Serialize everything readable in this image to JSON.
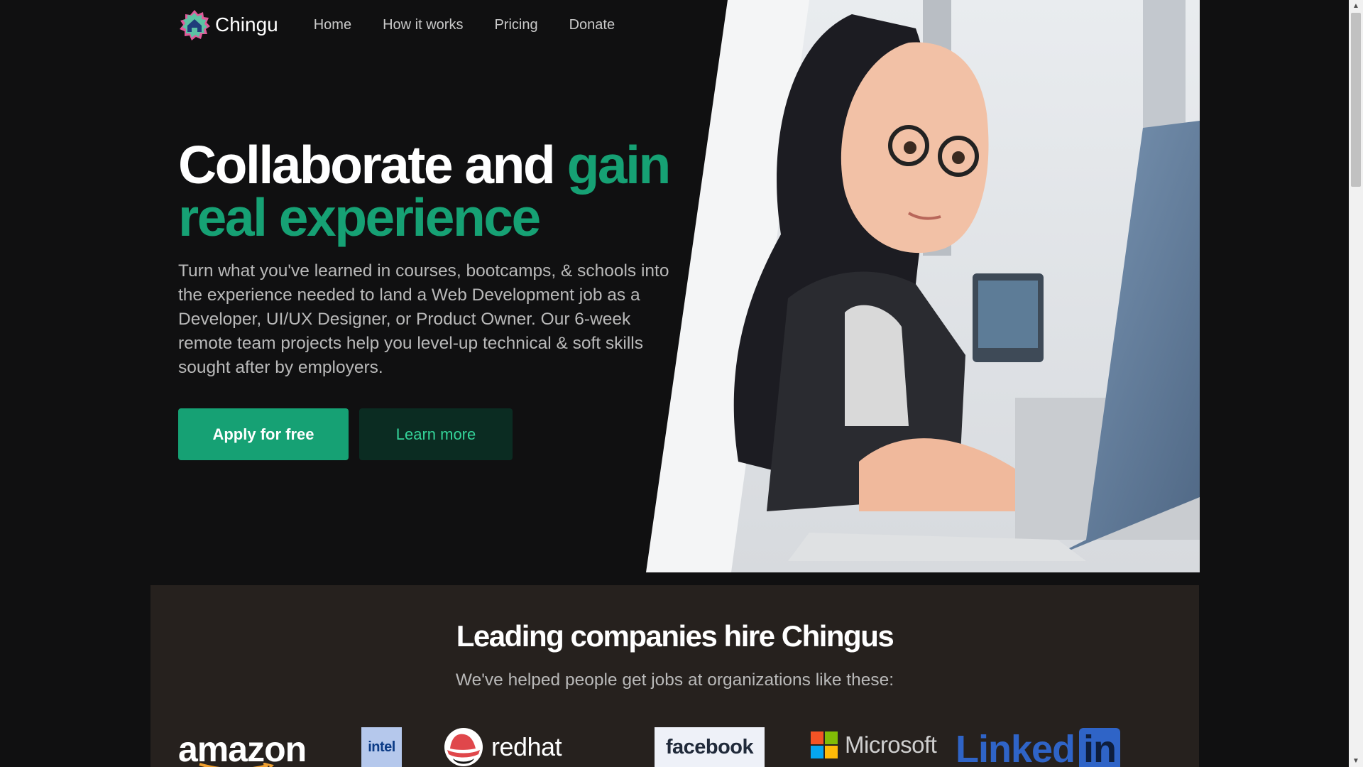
{
  "brand": {
    "name": "Chingu"
  },
  "nav": {
    "links": [
      {
        "label": "Home"
      },
      {
        "label": "How it works"
      },
      {
        "label": "Pricing"
      },
      {
        "label": "Donate"
      }
    ]
  },
  "hero": {
    "title_main": "Collaborate and",
    "title_accent": "gain real experience",
    "description": "Turn what you've learned in courses, bootcamps, & schools into the experience needed to land a Web Development job as a Developer, UI/UX Designer, or Product Owner. Our 6-week remote team projects help you level-up technical & soft skills sought after by employers.",
    "primary_button": "Apply for free",
    "secondary_button": "Learn more"
  },
  "companies": {
    "title": "Leading companies hire Chingus",
    "subtitle": "We've helped people get jobs at organizations like these:",
    "logos": {
      "amazon": "amazon",
      "intel": "intel",
      "redhat": "redhat",
      "facebook": "facebook",
      "microsoft": "Microsoft",
      "linkedin_a": "Linked",
      "linkedin_b": "in"
    }
  },
  "icons": {
    "brand_logo": "chingu-house-logo-icon",
    "scroll_up": "triangle-up-icon",
    "scroll_down": "triangle-down-icon"
  },
  "colors": {
    "accent": "#16a174",
    "background": "#101011",
    "secondary_button_bg": "#0b2c22",
    "companies_bg": "#26211e"
  }
}
